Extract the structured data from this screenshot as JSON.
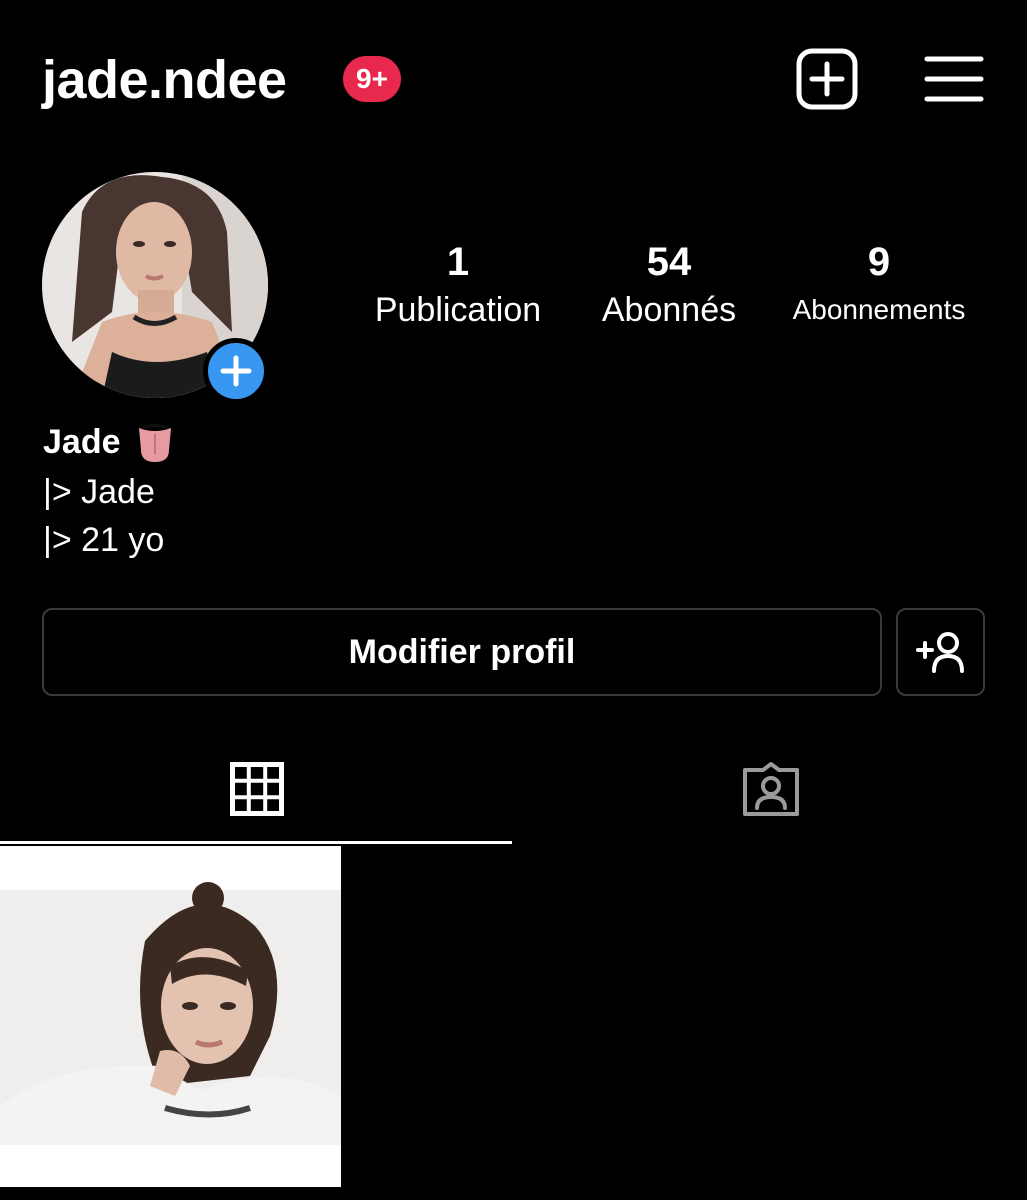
{
  "header": {
    "username": "jade.ndee",
    "notification_badge": "9+",
    "new_post_icon": "plus-square-icon",
    "menu_icon": "hamburger-menu-icon"
  },
  "profile": {
    "avatar": "profile-photo",
    "add_story_icon": "plus-icon",
    "stats": [
      {
        "value": "1",
        "label": "Publication"
      },
      {
        "value": "54",
        "label": "Abonnés"
      },
      {
        "value": "9",
        "label": "Abonnements"
      }
    ],
    "display_name": "Jade",
    "name_emoji": "tongue-face-emoji",
    "bio": [
      "|> Jade",
      "|> 21 yo"
    ]
  },
  "actions": {
    "edit_profile": "Modifier profil",
    "discover_people_icon": "add-person-icon"
  },
  "tabs": [
    {
      "name": "posts-grid",
      "icon": "grid-icon",
      "active": true
    },
    {
      "name": "tagged",
      "icon": "tagged-person-icon",
      "active": false
    }
  ],
  "posts": [
    {
      "thumbnail": "selfie-photo"
    }
  ],
  "colors": {
    "background": "#000000",
    "badge": "#e8294d",
    "accent_blue": "#3897f0",
    "border": "#3a3a3a"
  }
}
